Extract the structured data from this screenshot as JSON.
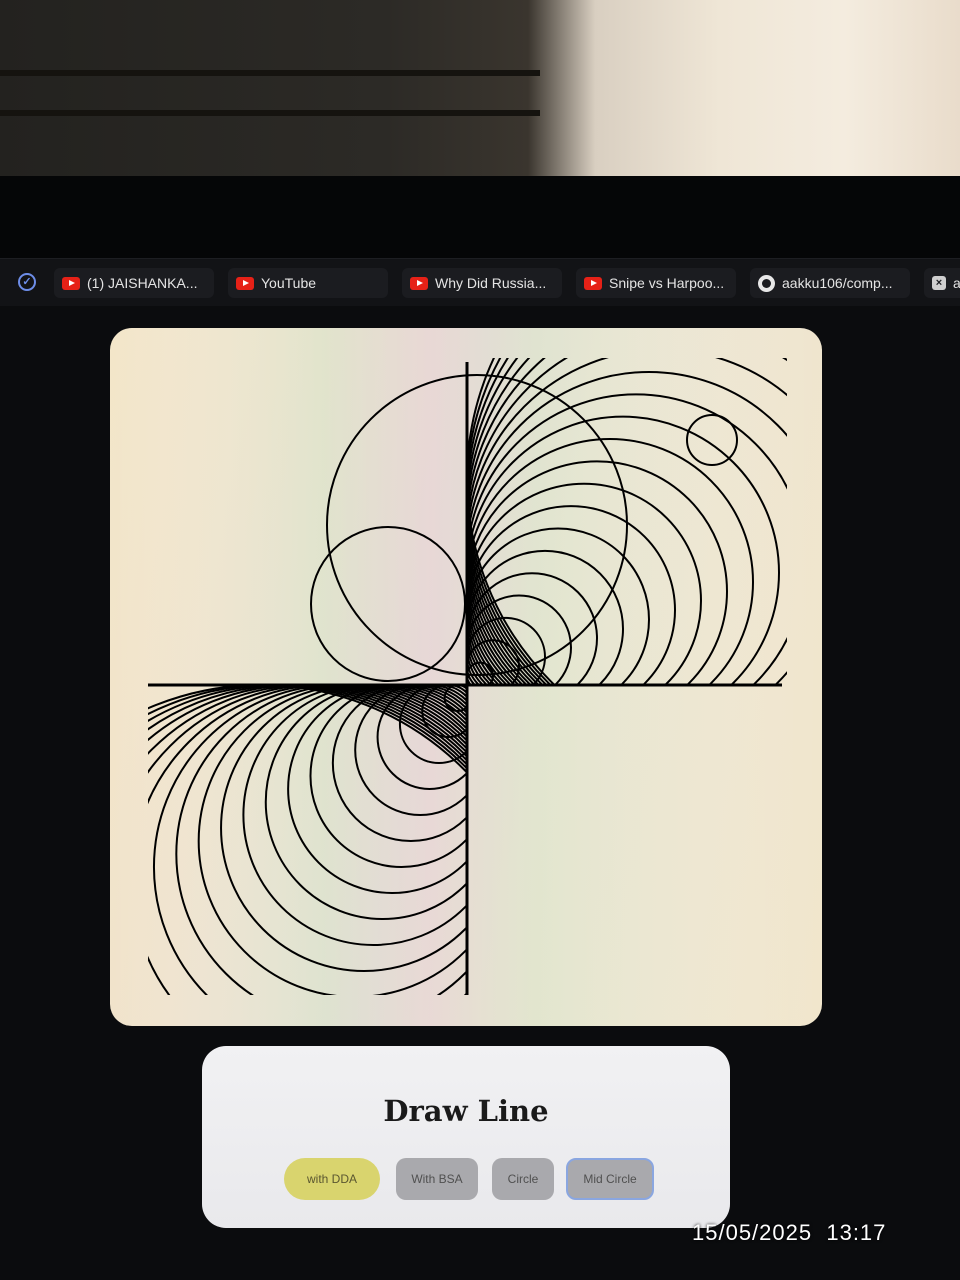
{
  "browser": {
    "tabs": [
      {
        "icon": "youtube-icon",
        "label": "(1) JAISHANKA..."
      },
      {
        "icon": "youtube-icon",
        "label": "YouTube"
      },
      {
        "icon": "youtube-icon",
        "label": "Why Did Russia..."
      },
      {
        "icon": "youtube-icon",
        "label": "Snipe vs Harpoo..."
      },
      {
        "icon": "github-icon",
        "label": "aakku106/comp..."
      },
      {
        "icon": "close-box-icon",
        "label": "a"
      }
    ]
  },
  "panel": {
    "title": "Draw Line",
    "buttons": {
      "dda": "with DDA",
      "bsa": "With BSA",
      "circle": "Circle",
      "mid_circle": "Mid Circle"
    }
  },
  "photo_overlay": {
    "date": "15/05/2025",
    "time": "13:17"
  },
  "colors": {
    "canvas_bg": "#f1e4c8",
    "stroke": "#000000",
    "dda_button": "#d9d46e",
    "grey_button": "#a9a9ad",
    "focus_ring": "#8aa6e0",
    "panel_bg": "#efeff1"
  }
}
